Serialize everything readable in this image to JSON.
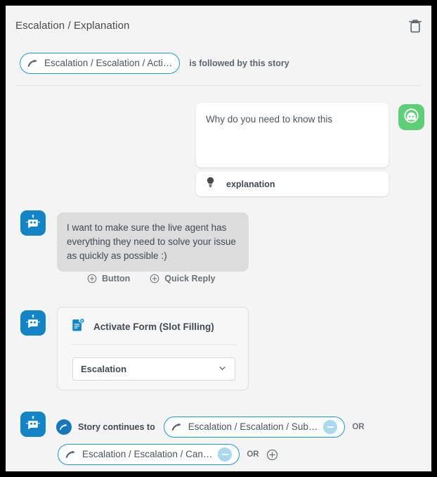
{
  "header": {
    "title": "Escalation / Explanation",
    "delete_icon": "trash-icon"
  },
  "follow_row": {
    "chip_icon": "curved-arrow-icon",
    "chip_label": "Escalation / Escalation / Acti…",
    "text": "is followed by this story"
  },
  "user_message": {
    "avatar_icon": "user-face-icon",
    "text": "Why do you need to know this",
    "intent_icon": "lightbulb-icon",
    "intent_label": "explanation"
  },
  "bot_message": {
    "avatar_icon": "robot-icon",
    "text": "I want to make sure the live agent has everything they need to solve your issue as quickly as possible :)",
    "actions": [
      {
        "icon": "plus-circle-icon",
        "label": "Button"
      },
      {
        "icon": "plus-circle-icon",
        "label": "Quick Reply"
      }
    ]
  },
  "form_block": {
    "avatar_icon": "robot-icon",
    "icon": "form-document-icon",
    "title": "Activate Form (Slot Filling)",
    "select_value": "Escalation",
    "select_icon": "chevron-down-icon"
  },
  "continues": {
    "avatar_icon": "robot-icon",
    "circle_icon": "curved-arrow-icon",
    "label": "Story continues to",
    "or_label": "OR",
    "or_label_2": "OR",
    "add_icon": "plus-circle-icon",
    "chips": [
      {
        "icon": "curved-arrow-icon",
        "label": "Escalation / Escalation / Sub…",
        "minus_icon": "minus-circle-icon"
      },
      {
        "icon": "curved-arrow-icon",
        "label": "Escalation / Escalation / Can…",
        "minus_icon": "minus-circle-icon"
      }
    ]
  },
  "colors": {
    "bot_blue": "#1384c6",
    "user_green": "#5ece77",
    "chip_border": "#1a9ad4",
    "page_bg": "#f4f4f4",
    "bubble_gray": "#dcdcdc"
  }
}
